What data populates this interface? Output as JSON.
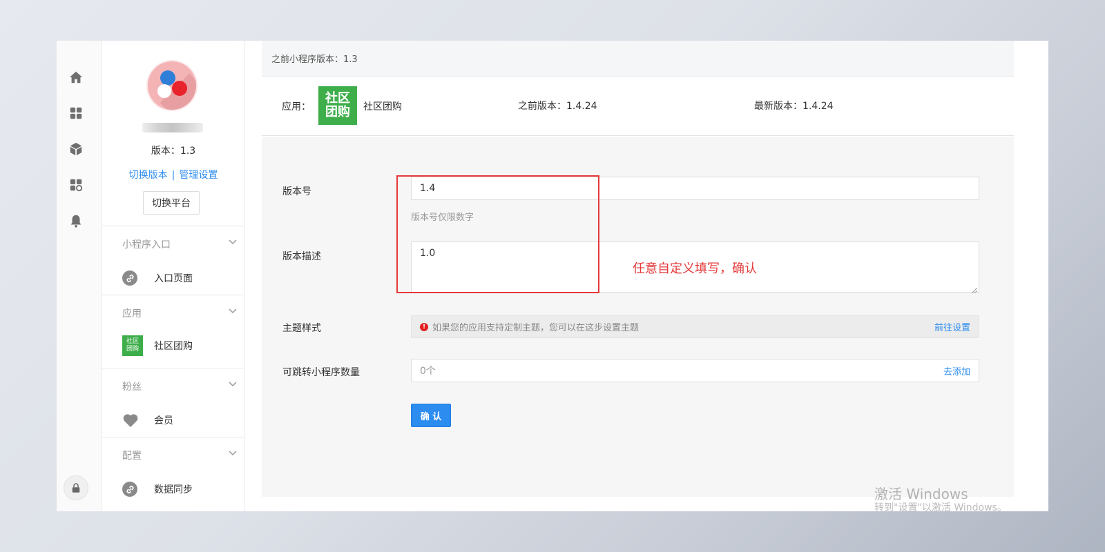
{
  "rail": {
    "icons": [
      "home-icon",
      "apps-icon",
      "cube-icon",
      "apps-settings-icon",
      "bell-icon",
      "lock-icon"
    ]
  },
  "panel": {
    "version": "版本：1.3",
    "switch_version": "切换版本",
    "separator": "|",
    "manage_settings": "管理设置",
    "switch_platform": "切换平台",
    "sections": [
      {
        "title": "小程序入口",
        "item": "入口页面",
        "icon": "link-icon"
      },
      {
        "title": "应用",
        "item": "社区团购",
        "icon": "app-icon",
        "icon_text": "社区团购"
      },
      {
        "title": "粉丝",
        "item": "会员",
        "icon": "heart-icon"
      },
      {
        "title": "配置",
        "item": "数据同步",
        "icon": "link-icon"
      }
    ]
  },
  "main": {
    "top_text": "之前小程序版本：1.3",
    "app_label": "应用：",
    "app_badge": "社区团购",
    "app_name": "社区团购",
    "prev_version": "之前版本：1.4.24",
    "latest_version": "最新版本：1.4.24"
  },
  "form": {
    "version_label": "版本号",
    "version_value": "1.4",
    "version_hint": "版本号仅限数字",
    "desc_label": "版本描述",
    "desc_value": "1.0",
    "theme_label": "主题样式",
    "theme_notice": "如果您的应用支持定制主题，您可以在这步设置主题",
    "theme_link": "前往设置",
    "jump_label": "可跳转小程序数量",
    "jump_value": "0个",
    "jump_link": "去添加",
    "confirm": "确 认"
  },
  "annotation": {
    "text": "任意自定义填写，确认",
    "color": "#e5393a"
  },
  "watermark": {
    "line1": "激活 Windows",
    "line2": "转到\"设置\"以激活 Windows。"
  },
  "colors": {
    "accent": "#2d8cf0",
    "app_green": "#3eae4b",
    "warning": "#e02020"
  }
}
